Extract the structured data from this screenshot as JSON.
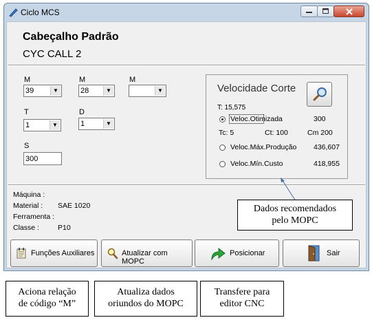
{
  "window": {
    "title": "Ciclo MCS",
    "header_title": "Cabeçalho Padrão",
    "header_subtitle": "CYC CALL 2"
  },
  "form": {
    "m1": {
      "label": "M",
      "value": "39"
    },
    "m2": {
      "label": "M",
      "value": "28"
    },
    "m3": {
      "label": "M",
      "value": ""
    },
    "t": {
      "label": "T",
      "value": "1"
    },
    "d": {
      "label": "D",
      "value": "1"
    },
    "s": {
      "label": "S",
      "value": "300"
    }
  },
  "velocity": {
    "title": "Velocidade Corte",
    "t_value": "T: 15,575",
    "options": [
      {
        "label": "Veloc.Otimizada",
        "value": "300",
        "selected": true
      },
      {
        "label": "Veloc.Máx.Produção",
        "value": "436,607",
        "selected": false
      },
      {
        "label": "Veloc.Mín.Custo",
        "value": "418,955",
        "selected": false
      }
    ],
    "tc": "Tc: 5",
    "ct": "Ct: 100",
    "cm": "Cm 200"
  },
  "info": {
    "maquina_label": "Máquina :",
    "material_label": "Material :",
    "material_value": "SAE 1020",
    "ferramenta_label": "Ferramenta :",
    "classe_label": "Classe :",
    "classe_value": "P10"
  },
  "buttons": {
    "funcoes": "Funções Auxiliares",
    "atualizar": "Atualizar com MOPC",
    "posicionar": "Posicionar",
    "sair": "Sair"
  },
  "notes": {
    "dados": [
      "Dados recomendados",
      "pelo MOPC"
    ],
    "aciona": [
      "Aciona relação",
      "de código “M”"
    ],
    "atualiza": [
      "Atualiza dados",
      "oriundos do MOPC"
    ],
    "transfere": [
      "Transfere para",
      "editor CNC"
    ]
  },
  "colors": {
    "title_bar": "#c6d6e6",
    "close_button": "#c8452e",
    "client_bg": "#f0f0f0"
  }
}
